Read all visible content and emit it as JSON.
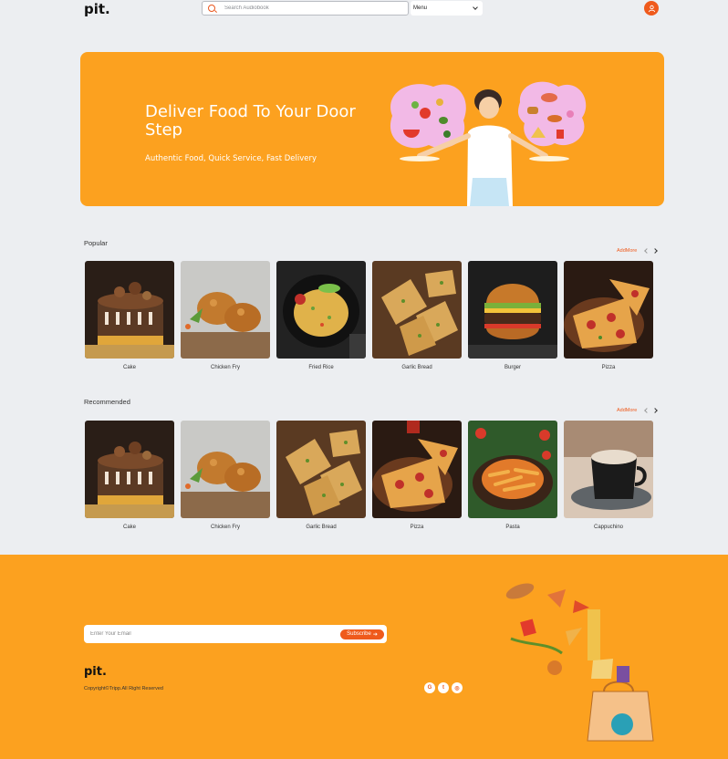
{
  "header": {
    "logo": "pit.",
    "search_placeholder": "Search Audiobook",
    "menu_label": "Menu"
  },
  "hero": {
    "title": "Deliver Food To Your Door Step",
    "subtitle": "Authentic Food, Quick Service, Fast Delivery"
  },
  "popular": {
    "title": "Popular",
    "addmore": "AddMore",
    "items": [
      {
        "label": "Cake"
      },
      {
        "label": "Chicken Fry"
      },
      {
        "label": "Fried Rice"
      },
      {
        "label": "Garlic Bread"
      },
      {
        "label": "Burger"
      },
      {
        "label": "Pizza"
      }
    ]
  },
  "recommended": {
    "title": "Recommended",
    "addmore": "AddMore",
    "items": [
      {
        "label": "Cake"
      },
      {
        "label": "Chicken Fry"
      },
      {
        "label": "Garlic Bread"
      },
      {
        "label": "Pizza"
      },
      {
        "label": "Pasta"
      },
      {
        "label": "Cappuchino"
      }
    ]
  },
  "footer": {
    "email_placeholder": "Enter Your Email",
    "subscribe_label": "Subscribe",
    "logo": "pit.",
    "copyright": "Copyright©Tripp.All Right Reserved",
    "socials": [
      {
        "icon": "google-icon",
        "glyph": "G"
      },
      {
        "icon": "twitter-icon",
        "glyph": "t"
      },
      {
        "icon": "instagram-icon",
        "glyph": "◎"
      }
    ]
  },
  "colors": {
    "accent": "#fca11f",
    "brand": "#ef5a1c",
    "background": "#eceef1"
  }
}
